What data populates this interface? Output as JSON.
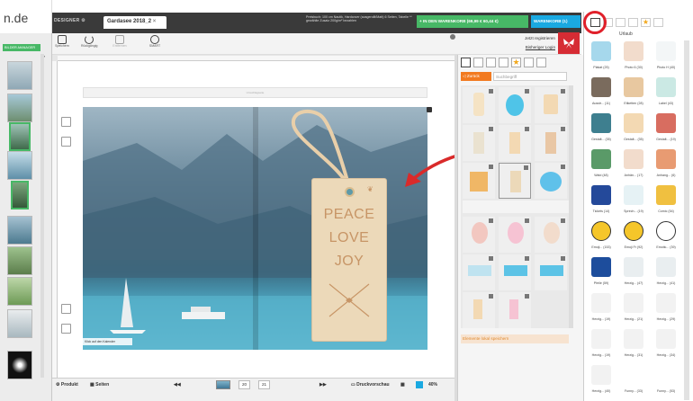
{
  "logo": {
    "text": "n.de"
  },
  "header": {
    "designer_label": "DESIGNER",
    "doc_tab": "Gardasee 2018_2",
    "price_info": "Preisbuch: 100 cm Nautik, Hardcover (ausgerollt/Matt) 6 Seiten, Tabelle ** gewählte Zusatz 200g/m² bezahlen",
    "cart_button": "+ IN DEN WARENKORB (69,99 € 60,44 €)",
    "cart_count": "WARENKORB (1)",
    "register": "Jetzt registrieren",
    "login": "Bisheriger Login"
  },
  "toolbar": {
    "tools": [
      "Speichern",
      "Rückgängig",
      "Entfernen",
      "SMART"
    ]
  },
  "left": {
    "manager_button": "BILDER-MANAGER"
  },
  "canvas": {
    "top_strip": "Umschlagseite",
    "page_tag": "Klick auf den Kalender",
    "tag_lines": [
      "PEACE",
      "LOVE",
      "JOY"
    ]
  },
  "bottom": {
    "product": "Produkt",
    "pages": "Seiten",
    "page_from": "20",
    "page_to": "21",
    "preview": "Druckvorschau",
    "zoom": "40%"
  },
  "mid": {
    "back": "Zurück",
    "search_placeholder": "Suchbegriff",
    "save_elements": "Elemente lokal speichern"
  },
  "right": {
    "category": "Urlaub",
    "items": [
      "Plakat (25)",
      "Photo 6 (30)",
      "Photo H (40)",
      "Ausstr... (11)",
      "Etiketten (28)",
      "Label (43)",
      "Gestalt... (35)",
      "Gestalt... (35)",
      "Gestalt... (19)",
      "Wald (48)",
      "Anhän... (17)",
      "Anhang... (6)",
      "Tickets (14)",
      "Sprech... (19)",
      "Comic (54)",
      "Emoji... (153)",
      "Emoji Fr (92)",
      "Emotic... (39)",
      "Pfeile (59)",
      "Herzig... (47)",
      "Herzig... (41)",
      "Herzig... (19)",
      "Herzig... (21)",
      "Herzig... (29)",
      "Herzig... (19)",
      "Herzig... (31)",
      "Herzig... (34)",
      "Herzig... (40)",
      "Funny... (33)",
      "Funny... (53)"
    ]
  },
  "colors": {
    "cart_green": "#47b866",
    "cart_blue": "#1aa9e1",
    "accent_red": "#d62c34",
    "highlight_red": "#e0202a",
    "back_orange": "#f27a20"
  }
}
